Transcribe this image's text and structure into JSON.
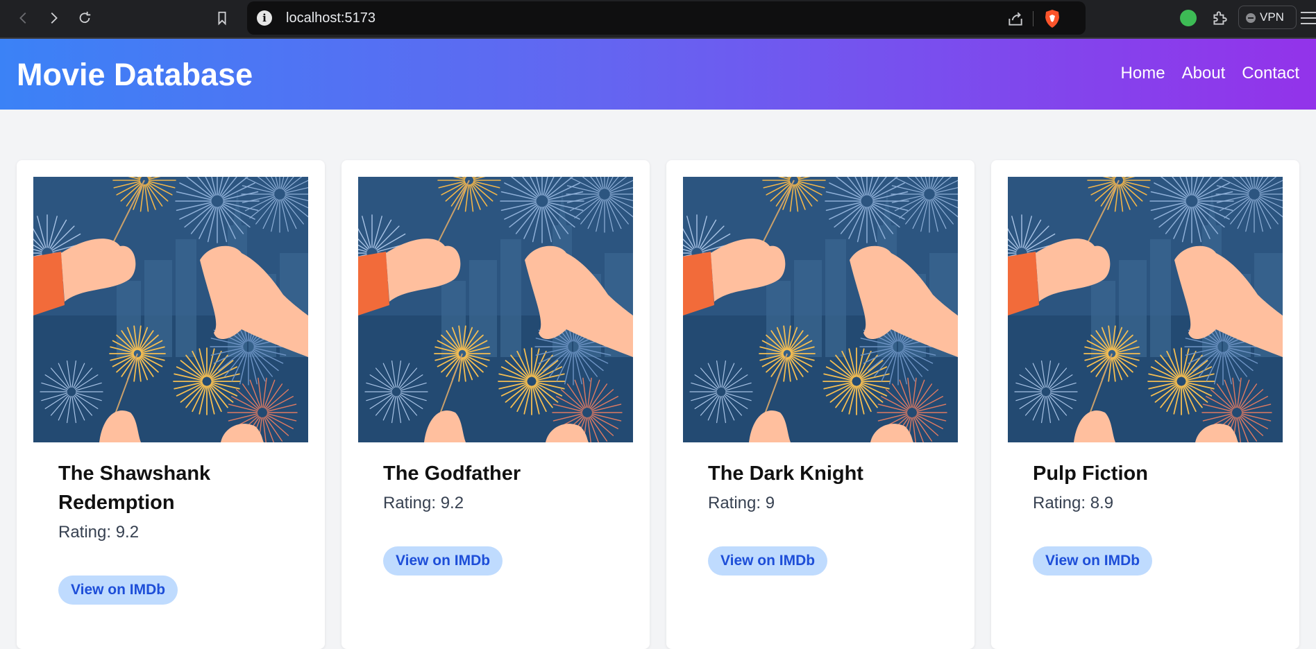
{
  "browser": {
    "url": "localhost:5173",
    "vpn_label": "VPN"
  },
  "header": {
    "title": "Movie Database",
    "nav": [
      {
        "label": "Home"
      },
      {
        "label": "About"
      },
      {
        "label": "Contact"
      }
    ]
  },
  "movies": [
    {
      "title": "The Shawshank Redemption",
      "rating": "Rating: 9.2",
      "button": "View on IMDb"
    },
    {
      "title": "The Godfather",
      "rating": "Rating: 9.2",
      "button": "View on IMDb"
    },
    {
      "title": "The Dark Knight",
      "rating": "Rating: 9",
      "button": "View on IMDb"
    },
    {
      "title": "Pulp Fiction",
      "rating": "Rating: 8.9",
      "button": "View on IMDb"
    }
  ],
  "colors": {
    "header_gradient_start": "#3b82f6",
    "header_gradient_end": "#9333ea",
    "button_bg": "#bfdbfe",
    "button_text": "#1d4ed8",
    "page_bg": "#f3f4f6"
  }
}
